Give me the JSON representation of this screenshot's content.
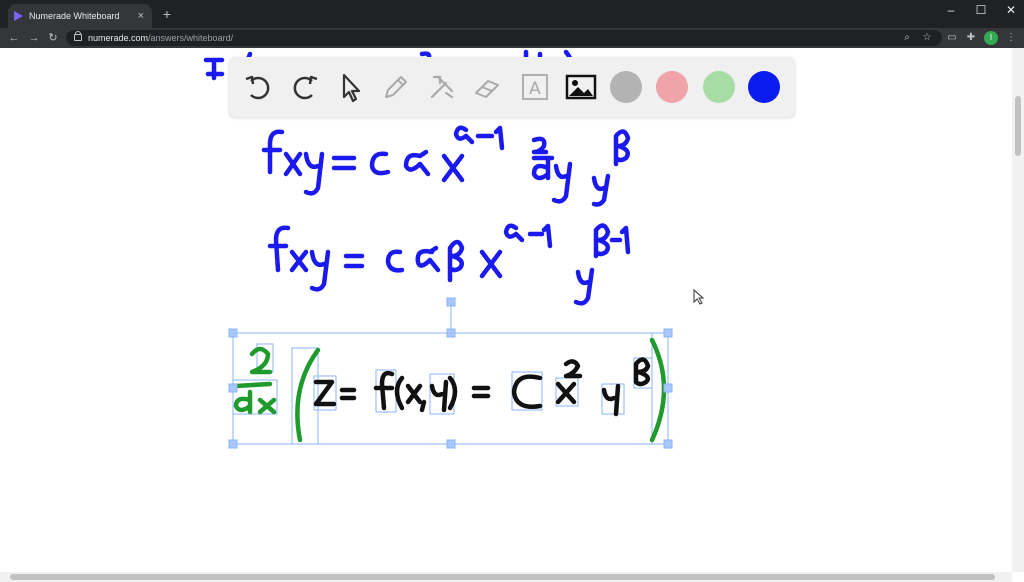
{
  "browser": {
    "tab_title": "Numerade Whiteboard",
    "tab_close": "×",
    "new_tab": "+",
    "url_host": "numerade.com",
    "url_path": "/answers/whiteboard/",
    "profile_initial": "I",
    "window_controls": [
      "–",
      "☐",
      "✕"
    ]
  },
  "toolbar": {
    "tools": [
      "undo-icon",
      "redo-icon",
      "pointer-icon",
      "pen-icon",
      "tools-icon",
      "eraser-icon",
      "text-icon",
      "image-icon"
    ],
    "colors": [
      "#b3b3b3",
      "#f0a3a8",
      "#a7dca5",
      "#0a1cf0"
    ],
    "text_tool_label": "A"
  }
}
